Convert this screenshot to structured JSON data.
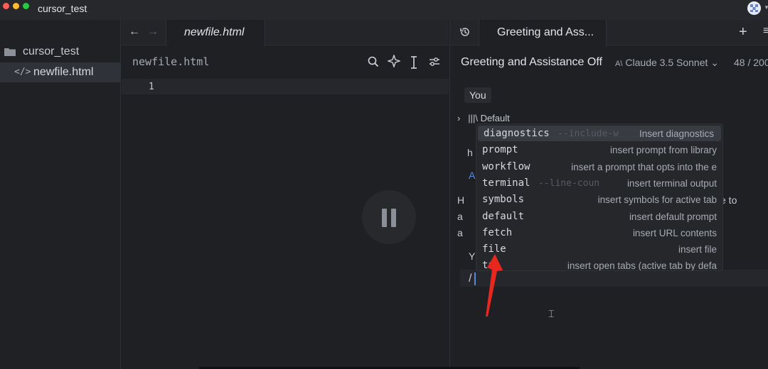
{
  "window": {
    "title": "cursor_test",
    "colors": {
      "close": "#ff5f57",
      "minimize": "#febc2e",
      "maximize": "#28c840"
    }
  },
  "sidebar": {
    "root_label": "cursor_test",
    "files": [
      {
        "label": "newfile.html",
        "icon": "code-icon",
        "icon_glyph": "</>",
        "selected": true
      }
    ]
  },
  "editor": {
    "tab_label": "newfile.html",
    "file_header": "newfile.html",
    "line_numbers": [
      "1"
    ]
  },
  "chat": {
    "tab_label": "Greeting and Ass...",
    "title": "Greeting and Assistance Off",
    "model": "Claude 3.5 Sonnet",
    "model_icon_text": "A\\",
    "counter": "48 / 200",
    "you_label": "You",
    "default_label": "Default",
    "background_fragments": {
      "h": "h",
      "a_link": "A",
      "h2": "H",
      "a1": "a",
      "a2": "a",
      "y": "Y",
      "tail": "e to"
    },
    "input_value": "/"
  },
  "slash_menu": {
    "items": [
      {
        "cmd": "diagnostics",
        "hint": "--include-w",
        "desc": "Insert diagnostics",
        "selected": true
      },
      {
        "cmd": "prompt",
        "hint": "",
        "desc": "insert prompt from library",
        "selected": false
      },
      {
        "cmd": "workflow",
        "hint": "",
        "desc": "insert a prompt that opts into the e",
        "selected": false
      },
      {
        "cmd": "terminal",
        "hint": "--line-coun",
        "desc": "insert terminal output",
        "selected": false
      },
      {
        "cmd": "symbols",
        "hint": "",
        "desc": "insert symbols for active tab",
        "selected": false
      },
      {
        "cmd": "default",
        "hint": "",
        "desc": "insert default prompt",
        "selected": false
      },
      {
        "cmd": "fetch",
        "hint": "",
        "desc": "insert URL contents",
        "selected": false
      },
      {
        "cmd": "file",
        "hint": "",
        "desc": "insert file",
        "selected": false
      },
      {
        "cmd": "tab",
        "hint": "",
        "desc": "insert open tabs (active tab by defa",
        "selected": false
      }
    ]
  },
  "overlay": {
    "pause_icon": "pause-icon",
    "annotation": "red-arrow",
    "annotation_color": "#e8281f"
  }
}
